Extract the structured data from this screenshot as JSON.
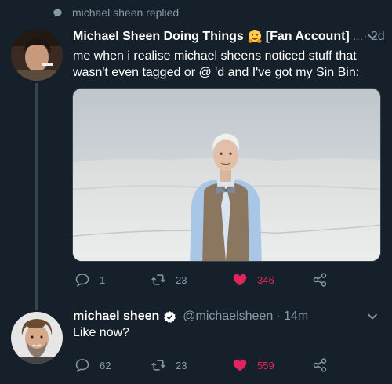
{
  "context": {
    "icon": "chat-bubble-icon",
    "text": "michael sheen replied"
  },
  "tweets": [
    {
      "name": "Michael Sheen Doing Things",
      "emoji": "hugging-face-emoji",
      "tag": "[Fan Account]",
      "meta": "...· 2d",
      "text": "me when i realise michael sheens noticed stuff that wasn't even tagged or @ 'd and I've got my Sin Bin:",
      "media": "photo-man-in-bowtie-on-sand-dunes",
      "replies": "1",
      "retweets": "23",
      "likes": "346"
    },
    {
      "name": "michael sheen",
      "handle": "@michaelsheen",
      "meta": "· 14m",
      "text": "Like now?",
      "replies": "62",
      "retweets": "23",
      "likes": "559"
    }
  ],
  "colors": {
    "background": "#15202b",
    "secondary_text": "#8899a6",
    "like_active": "#e0245e",
    "verified": "#ffffff",
    "thread_line": "#38444d"
  }
}
